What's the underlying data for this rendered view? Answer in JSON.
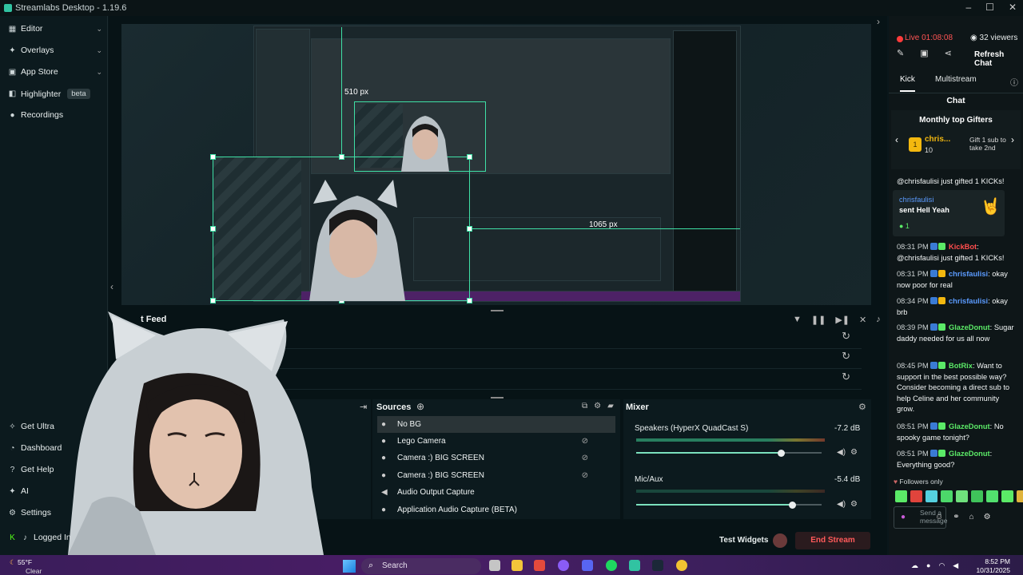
{
  "app": {
    "title": "Streamlabs Desktop - 1.19.6"
  },
  "nav": {
    "items": [
      {
        "label": "Editor"
      },
      {
        "label": "Overlays"
      },
      {
        "label": "App Store"
      },
      {
        "label": "Highlighter",
        "badge": "beta"
      },
      {
        "label": "Recordings"
      }
    ],
    "bottom": [
      {
        "label": "Get Ultra"
      },
      {
        "label": "Dashboard"
      },
      {
        "label": "Get Help"
      },
      {
        "label": "AI"
      },
      {
        "label": "Settings"
      },
      {
        "label": "Logged In"
      }
    ]
  },
  "preview": {
    "width_label": "510 px",
    "height_label": "1065 px"
  },
  "feed": {
    "title": "t Feed"
  },
  "sources": {
    "title": "Sources",
    "items": [
      {
        "label": "No BG",
        "icon": "user-icon"
      },
      {
        "label": "Lego Camera",
        "icon": "user-icon"
      },
      {
        "label": "Camera :) BIG SCREEN",
        "icon": "user-icon"
      },
      {
        "label": "Camera :) BIG SCREEN",
        "icon": "user-icon"
      },
      {
        "label": "Audio Output Capture",
        "icon": "speaker-icon"
      },
      {
        "label": "Application Audio Capture (BETA)",
        "icon": "user-icon"
      }
    ]
  },
  "mixer": {
    "title": "Mixer",
    "channels": [
      {
        "label": "Speakers (HyperX QuadCast S)",
        "db": "-7.2 dB",
        "level": 0.78
      },
      {
        "label": "Mic/Aux",
        "db": "-5.4 dB",
        "level": 0.84
      }
    ]
  },
  "footer": {
    "test_widgets": "Test Widgets",
    "end_stream": "End Stream"
  },
  "chat": {
    "live": "Live 01:08:08",
    "viewers": "32 viewers",
    "refresh": "Refresh Chat",
    "tabs": [
      "Kick",
      "Multistream"
    ],
    "title": "Chat",
    "gifters_title": "Monthly top Gifters",
    "gifter_name": "chris...",
    "gifter_count": "10",
    "gift_cta": "Gift 1 sub to take 2nd",
    "messages": [
      {
        "time": "",
        "user": "",
        "text": "@chrisfaulisi just gifted 1 KICKs!",
        "color": "b"
      },
      {
        "time": "",
        "user": "chrisfaulisi",
        "text": "sent Hell Yeah",
        "color": "b",
        "special": true
      },
      {
        "time": "08:31 PM",
        "user": "KickBot",
        "text": "@chrisfaulisi just gifted 1 KICKs!",
        "color": "r"
      },
      {
        "time": "08:31 PM",
        "user": "chrisfaulisi",
        "text": "okay now poor for real",
        "color": "b"
      },
      {
        "time": "08:34 PM",
        "user": "chrisfaulisi",
        "text": "okay brb",
        "color": "b"
      },
      {
        "time": "08:39 PM",
        "user": "GlazeDonut",
        "text": "Sugar daddy needed for us all now",
        "color": "g"
      },
      {
        "time": "08:45 PM",
        "user": "BotRix",
        "text": "Want to support in the best possible way? Consider becoming a direct sub to help Celine and her community grow.",
        "color": "g"
      },
      {
        "time": "08:51 PM",
        "user": "GlazeDonut",
        "text": "No spooky game tonight?",
        "color": "g"
      },
      {
        "time": "08:51 PM",
        "user": "GlazeDonut",
        "text": "Everything good?",
        "color": "g"
      }
    ],
    "followers_only": "Followers only",
    "send_placeholder": "Send a message"
  },
  "taskbar": {
    "weather_temp": "55°F",
    "weather_desc": "Clear",
    "search": "Search",
    "time": "8:52 PM",
    "date": "10/31/2025"
  }
}
